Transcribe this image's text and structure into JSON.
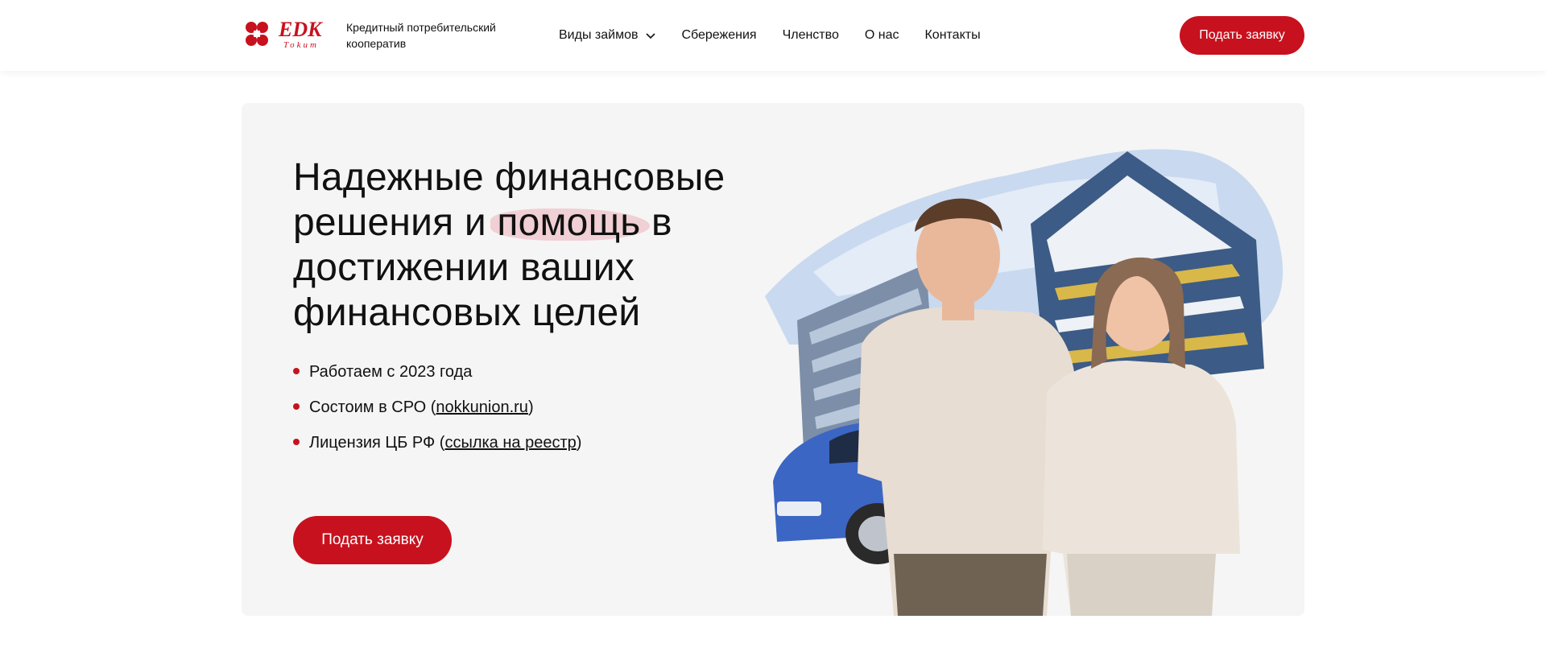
{
  "header": {
    "logo_text": "EDK",
    "logo_sub": "Tokum",
    "org_name": "Кредитный потребительский кооператив",
    "nav": [
      {
        "label": "Виды займов",
        "has_dropdown": true
      },
      {
        "label": "Сбережения"
      },
      {
        "label": "Членство"
      },
      {
        "label": "О нас"
      },
      {
        "label": "Контакты"
      }
    ],
    "cta_label": "Подать заявку"
  },
  "hero": {
    "title_part1": "Надежные финансовые решения и ",
    "title_highlight": "помощь",
    "title_part2": " в достижении ваших финансовых целей",
    "bullets": [
      {
        "text": "Работаем с 2023 года"
      },
      {
        "prefix": "Состоим в СРО (",
        "link": "nokkunion.ru",
        "suffix": ")"
      },
      {
        "prefix": "Лицензия ЦБ РФ (",
        "link": "ссылка на реестр",
        "suffix": ")"
      }
    ],
    "cta_label": "Подать заявку"
  },
  "colors": {
    "brand_red": "#c8111e",
    "hero_bg": "#f5f5f5"
  }
}
